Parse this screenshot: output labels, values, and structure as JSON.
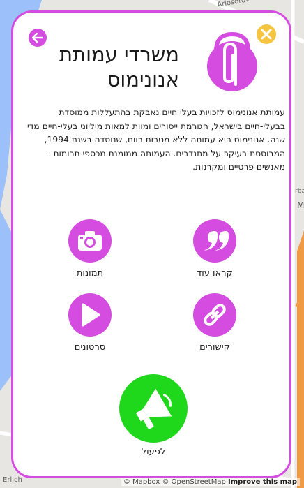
{
  "map": {
    "attribution_mapbox": "© Mapbox",
    "attribution_osm": "© OpenStreetMap",
    "attribution_improve": "Improve this map",
    "street_top": "Arlosorov",
    "street_bottom": "Erlich",
    "edge_label_1": "rba",
    "edge_label_2": "M"
  },
  "card": {
    "title": "משרדי עמותת אנונימוס",
    "description": "עמותת אנונימוס לזכויות בעלי חיים נאבקת בהתעללות ממוסדת בבעלי-חיים בישראל, הגורמת ייסורים ומוות למאות מיליוני בעלי-חיים מדי שנה. אנונימוס היא עמותה ללא מטרות רווח, שנוסדה בשנת 1994, המבוססת בעיקר על מתנדבים. העמותה ממומנת מכספי תרומות – מאנשים פרטיים ומקרנות.",
    "actions": {
      "read_more": "קראו עוד",
      "photos": "תמונות",
      "links": "קישורים",
      "videos": "סרטונים",
      "act": "לפעול"
    }
  },
  "colors": {
    "accent": "#d54ce0",
    "close": "#f5c542",
    "act": "#1fd81c"
  }
}
